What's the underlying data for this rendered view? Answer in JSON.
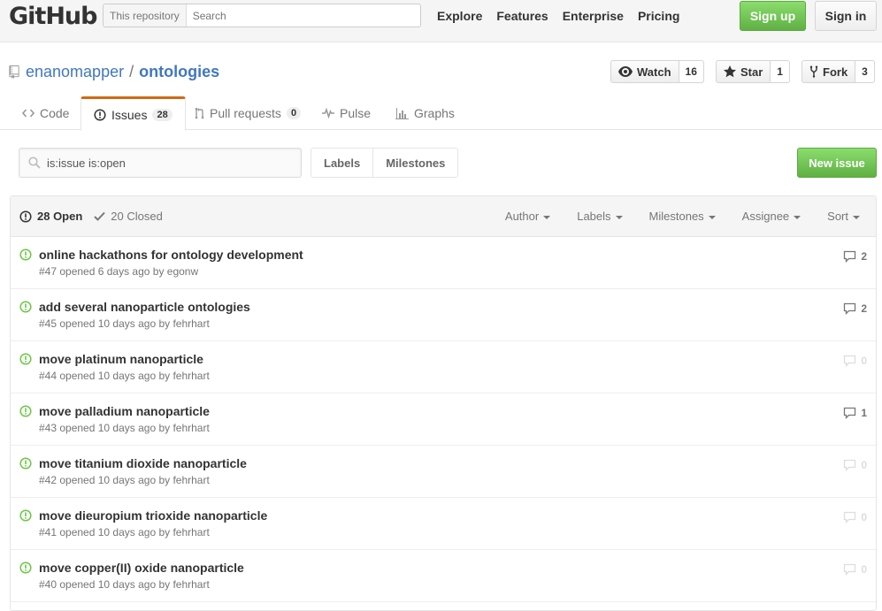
{
  "header": {
    "logo": "GitHub",
    "search_scope": "This repository",
    "search_placeholder": "Search",
    "nav": [
      "Explore",
      "Features",
      "Enterprise",
      "Pricing"
    ],
    "signup_label": "Sign up",
    "signin_label": "Sign in"
  },
  "repo": {
    "owner": "enanomapper",
    "separator": "/",
    "name": "ontologies",
    "watch_label": "Watch",
    "watch_count": "16",
    "star_label": "Star",
    "star_count": "1",
    "fork_label": "Fork",
    "fork_count": "3"
  },
  "tabs": {
    "code": "Code",
    "issues": "Issues",
    "issues_count": "28",
    "pulls": "Pull requests",
    "pulls_count": "0",
    "pulse": "Pulse",
    "graphs": "Graphs"
  },
  "subnav": {
    "filter_value": "is:issue is:open",
    "labels": "Labels",
    "milestones": "Milestones",
    "new_issue": "New issue"
  },
  "issues_header": {
    "open": "28 Open",
    "closed": "20 Closed",
    "filters": [
      "Author",
      "Labels",
      "Milestones",
      "Assignee",
      "Sort"
    ]
  },
  "issues": [
    {
      "title": "online hackathons for ontology development",
      "meta": "#47 opened 6 days ago by egonw",
      "comments": "2"
    },
    {
      "title": "add several nanoparticle ontologies",
      "meta": "#45 opened 10 days ago by fehrhart",
      "comments": "2"
    },
    {
      "title": "move platinum nanoparticle",
      "meta": "#44 opened 10 days ago by fehrhart",
      "comments": "0"
    },
    {
      "title": "move palladium nanoparticle",
      "meta": "#43 opened 10 days ago by fehrhart",
      "comments": "1"
    },
    {
      "title": "move titanium dioxide nanoparticle",
      "meta": "#42 opened 10 days ago by fehrhart",
      "comments": "0"
    },
    {
      "title": "move dieuropium trioxide nanoparticle",
      "meta": "#41 opened 10 days ago by fehrhart",
      "comments": "0"
    },
    {
      "title": "move copper(II) oxide nanoparticle",
      "meta": "#40 opened 10 days ago by fehrhart",
      "comments": "0"
    }
  ],
  "colors": {
    "link": "#4078c0",
    "open_green": "#6cc644",
    "tab_accent": "#d26911"
  }
}
